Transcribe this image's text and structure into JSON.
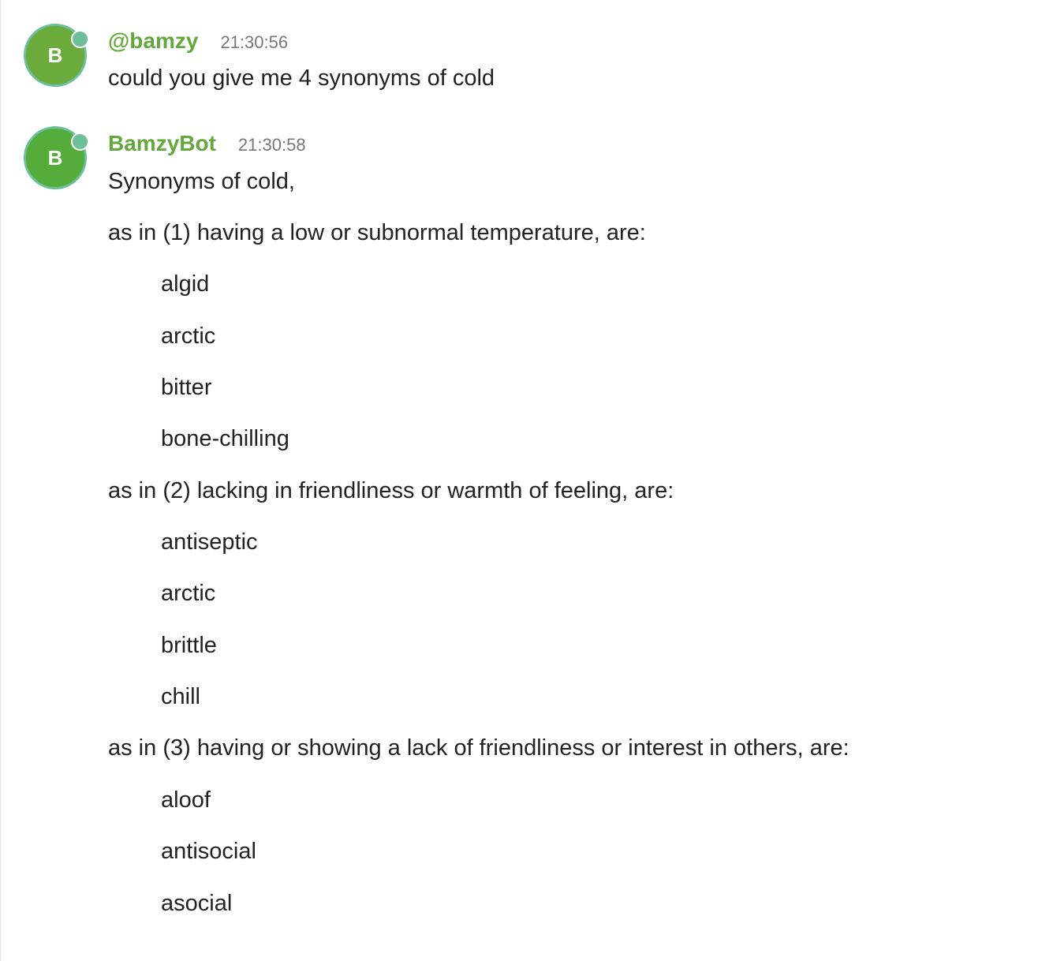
{
  "colors": {
    "author_name": "#63a83a",
    "avatar_user_bg": "#6aab3c",
    "avatar_bot_bg": "#54ad3a",
    "presence_dot": "#6dbf9a",
    "text": "#222222",
    "timestamp": "#777777"
  },
  "messages": [
    {
      "avatar_letter": "B",
      "author": "@bamzy",
      "timestamp": "21:30:56",
      "lines": [
        {
          "text": "could you give me 4 synonyms of cold",
          "indent": false
        }
      ]
    },
    {
      "avatar_letter": "B",
      "author": "BamzyBot",
      "timestamp": "21:30:58",
      "lines": [
        {
          "text": "Synonyms of cold,",
          "indent": false
        },
        {
          "text": "as in (1) having a low or subnormal temperature, are:",
          "indent": false
        },
        {
          "text": "algid",
          "indent": true
        },
        {
          "text": "arctic",
          "indent": true
        },
        {
          "text": "bitter",
          "indent": true
        },
        {
          "text": "bone-chilling",
          "indent": true
        },
        {
          "text": "as in (2) lacking in friendliness or warmth of feeling, are:",
          "indent": false
        },
        {
          "text": "antiseptic",
          "indent": true
        },
        {
          "text": "arctic",
          "indent": true
        },
        {
          "text": "brittle",
          "indent": true
        },
        {
          "text": "chill",
          "indent": true
        },
        {
          "text": "as in (3) having or showing a lack of friendliness or interest in others, are:",
          "indent": false
        },
        {
          "text": "aloof",
          "indent": true
        },
        {
          "text": "antisocial",
          "indent": true
        },
        {
          "text": "asocial",
          "indent": true
        }
      ]
    }
  ]
}
